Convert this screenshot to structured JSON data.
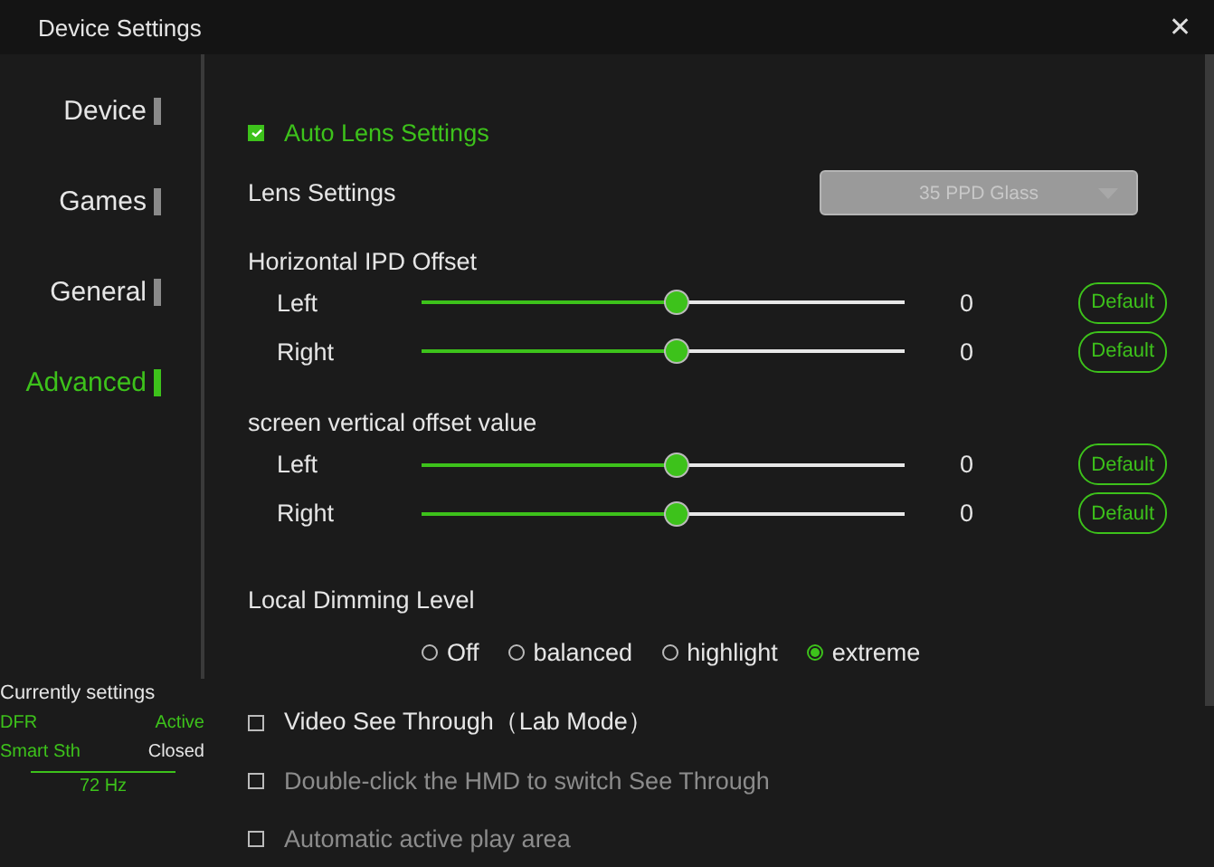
{
  "window": {
    "title": "Device Settings",
    "close": "✕"
  },
  "sidebar": {
    "items": [
      {
        "label": "Device",
        "selected": false
      },
      {
        "label": "Games",
        "selected": false
      },
      {
        "label": "General",
        "selected": false
      },
      {
        "label": "Advanced",
        "selected": true
      }
    ]
  },
  "status": {
    "title": "Currently settings",
    "rows": [
      {
        "name": "DFR",
        "value": "Active",
        "active": true
      },
      {
        "name": "Smart Sth",
        "value": "Closed",
        "active": false
      }
    ],
    "refresh_rate": "72 Hz"
  },
  "auto_lens": {
    "label": "Auto Lens Settings",
    "checked": true
  },
  "lens_settings": {
    "label": "Lens Settings",
    "value": "35 PPD Glass",
    "disabled": true
  },
  "slider_groups": [
    {
      "title": "Horizontal IPD Offset",
      "sliders": [
        {
          "label": "Left",
          "level": 0.5,
          "reading": "0",
          "button": "Default"
        },
        {
          "label": "Right",
          "level": 0.5,
          "reading": "0",
          "button": "Default"
        }
      ]
    },
    {
      "title": "screen vertical offset value",
      "sliders": [
        {
          "label": "Left",
          "level": 0.5,
          "reading": "0",
          "button": "Default"
        },
        {
          "label": "Right",
          "level": 0.5,
          "reading": "0",
          "button": "Default"
        }
      ]
    }
  ],
  "dimming": {
    "title": "Local Dimming Level",
    "options": [
      {
        "label": "Off",
        "selected": false
      },
      {
        "label": "balanced",
        "selected": false
      },
      {
        "label": "highlight",
        "selected": false
      },
      {
        "label": "extreme",
        "selected": true
      }
    ]
  },
  "options": [
    {
      "label": "Video See Through（Lab Mode）",
      "checked": false,
      "disabled": false
    },
    {
      "label": "Double-click the HMD to switch See Through",
      "checked": false,
      "disabled": true
    },
    {
      "label": "Automatic active play area",
      "checked": false,
      "disabled": true
    }
  ]
}
